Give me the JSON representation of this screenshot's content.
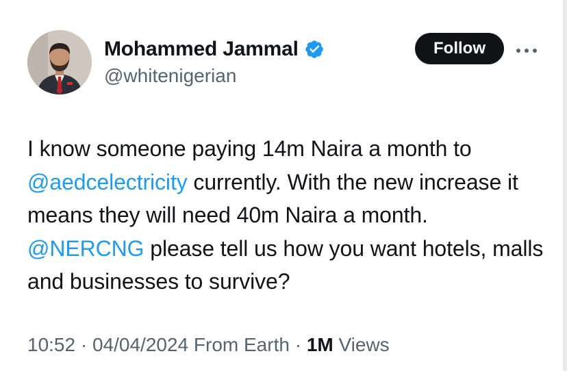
{
  "author": {
    "display_name": "Mohammed Jammal",
    "handle": "@whitenigerian",
    "verified": true,
    "verified_color": "#1d9bf0"
  },
  "actions": {
    "follow_label": "Follow",
    "more_icon": "more-horizontal-icon"
  },
  "tweet": {
    "segments": [
      {
        "text": "I know someone paying 14m Naira a month to ",
        "type": "text"
      },
      {
        "text": "@aedcelectricity",
        "type": "mention"
      },
      {
        "text": " currently. With the new increase it means they will need 40m Naira a month. ",
        "type": "text"
      },
      {
        "text": "@NERCNG",
        "type": "mention"
      },
      {
        "text": " please tell us how you want hotels, malls and businesses to survive?",
        "type": "text"
      }
    ]
  },
  "meta": {
    "time": "10:52",
    "separator1": " · ",
    "date": "04/04/2024",
    "source": " From Earth",
    "separator2": " · ",
    "views_count": "1M",
    "views_label": " Views"
  },
  "colors": {
    "text_primary": "#0f1419",
    "text_secondary": "#536471",
    "link": "#1d9bf0",
    "button_bg": "#0f1419"
  }
}
